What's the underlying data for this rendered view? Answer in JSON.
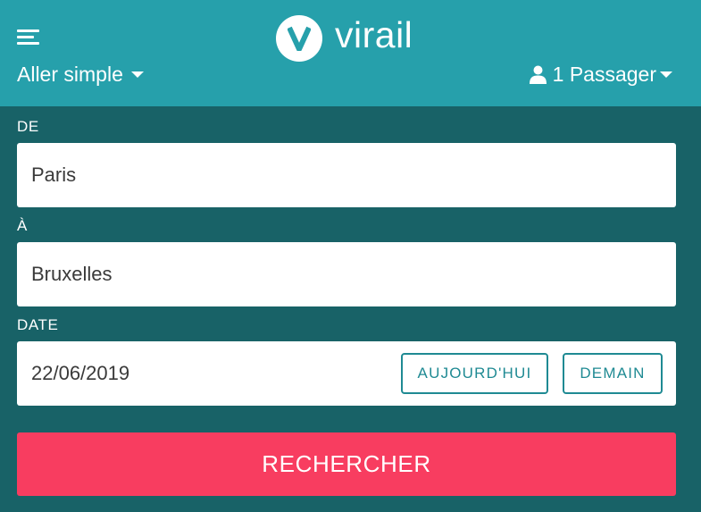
{
  "header": {
    "logo_text": "virail",
    "trip_type": "Aller simple",
    "passengers": "1 Passager",
    "icons": {
      "menu": "hamburger-menu-icon",
      "user": "user-icon",
      "dropdown": "caret-down-icon"
    }
  },
  "form": {
    "from": {
      "label": "DE",
      "value": "Paris"
    },
    "to": {
      "label": "À",
      "value": "Bruxelles"
    },
    "date": {
      "label": "DATE",
      "value": "22/06/2019",
      "today_label": "AUJOURD'HUI",
      "tomorrow_label": "DEMAIN"
    },
    "search_label": "RECHERCHER"
  },
  "colors": {
    "header_bg": "#26a0ab",
    "body_bg": "#186267",
    "accent": "#1f8a93",
    "search_button": "#f83d60"
  }
}
